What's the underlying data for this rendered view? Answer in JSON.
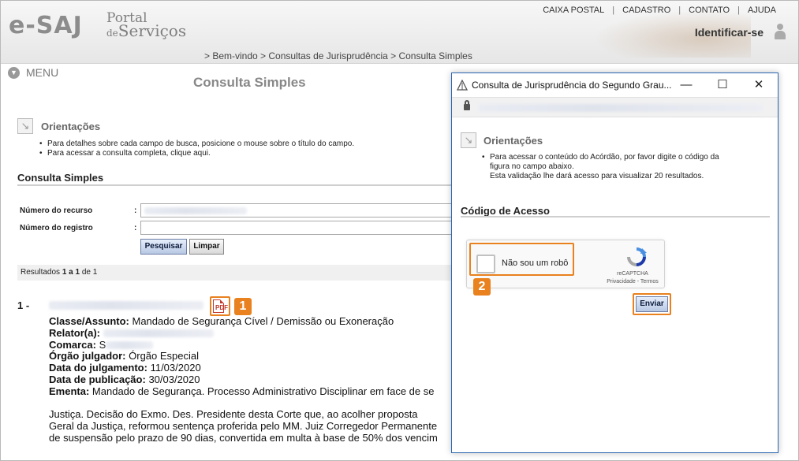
{
  "header": {
    "logo_text": "e-SAJ",
    "portal_line1": "Portal",
    "portal_line2": "de",
    "portal_line3": "Serviços",
    "top_nav": [
      "CAIXA POSTAL",
      "CADASTRO",
      "CONTATO",
      "AJUDA"
    ],
    "identify_label": "Identificar-se",
    "breadcrumb": "> Bem-vindo > Consultas de Jurisprudência > Consulta Simples"
  },
  "menu_label": "MENU",
  "page_title": "Consulta Simples",
  "orientacoes": {
    "title": "Orientações",
    "items": [
      "Para detalhes sobre cada campo de busca, posicione o mouse sobre o título do campo.",
      "Para acessar a consulta completa, clique aqui."
    ]
  },
  "form": {
    "section_title": "Consulta Simples",
    "fields": [
      {
        "label": "Número do recurso",
        "colon": ":"
      },
      {
        "label": "Número do registro",
        "colon": ":"
      }
    ],
    "search_button": "Pesquisar",
    "clear_button": "Limpar"
  },
  "results": {
    "label_prefix": "Resultados",
    "from": "1",
    "word_a": "a",
    "to": "1",
    "word_de": "de",
    "total": "1"
  },
  "result_item": {
    "index": "1 -",
    "callout_number": "1",
    "lines": [
      {
        "label": "Classe/Assunto:",
        "value": "Mandado de Segurança Cível / Demissão ou Exoneração"
      },
      {
        "label": "Relator(a):",
        "value": ""
      },
      {
        "label": "Comarca:",
        "value": "S"
      },
      {
        "label": "Órgão julgador:",
        "value": "Órgão Especial"
      },
      {
        "label": "Data do julgamento:",
        "value": "11/03/2020"
      },
      {
        "label": "Data de publicação:",
        "value": "30/03/2020"
      },
      {
        "label": "Ementa:",
        "value": "Mandado de Segurança. Processo Administrativo Disciplinar em face de se"
      }
    ],
    "ementa_continuation": [
      "Justiça. Decisão do Exmo. Des. Presidente desta Corte que, ao acolher proposta",
      "Geral da Justiça, reformou sentença proferida pelo MM. Juiz Corregedor Permanente",
      "de suspensão pelo prazo de 90 dias, convertida em multa à base de 50% dos vencim"
    ]
  },
  "popup": {
    "title": "Consulta de Jurisprudência do Segundo Grau...",
    "minimize": "—",
    "maximize": "☐",
    "close": "✕",
    "orientacoes_title": "Orientações",
    "orientacoes_text_1": "Para acessar o conteúdo do Acórdão, por favor digite o código da",
    "orientacoes_text_2": "figura no campo abaixo.",
    "orientacoes_text_3": "Esta validação lhe dará acesso para visualizar 20 resultados.",
    "codigo_title": "Código de Acesso",
    "captcha_label": "Não sou um robô",
    "captcha_brand": "reCAPTCHA",
    "captcha_links": "Privacidade - Termos",
    "submit_button": "Enviar",
    "callout_number": "2"
  },
  "colors": {
    "callout": "#e8811e",
    "popup_border": "#2b67b1"
  }
}
